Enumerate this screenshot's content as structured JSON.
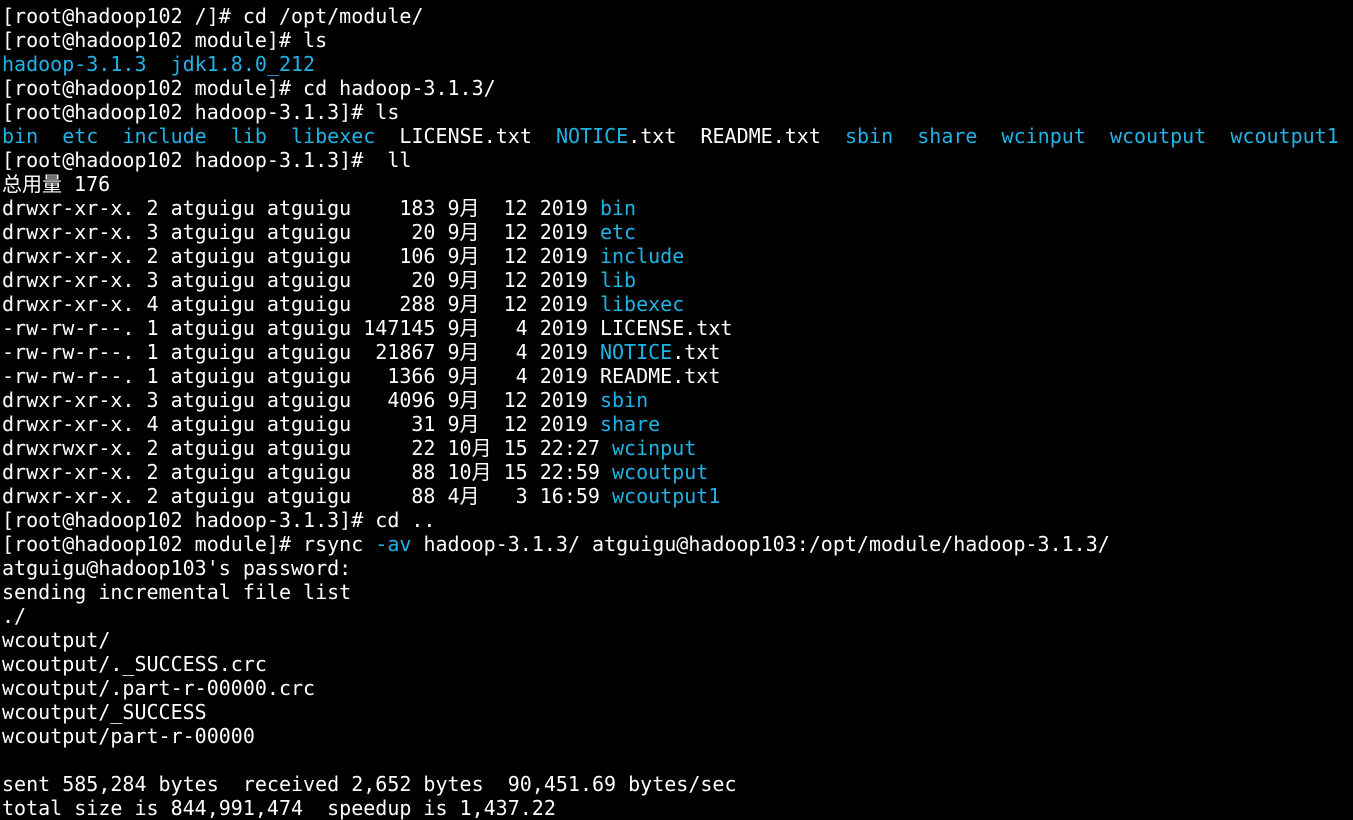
{
  "colors": {
    "background": "#000000",
    "foreground": "#ffffff",
    "directory": "#1fb3e6"
  },
  "lines": [
    [
      {
        "t": "[root@hadoop102 /]# cd /opt/module/",
        "c": "white"
      }
    ],
    [
      {
        "t": "[root@hadoop102 module]# ls",
        "c": "white"
      }
    ],
    [
      {
        "t": "hadoop-3.1.3",
        "c": "blue"
      },
      {
        "t": "  ",
        "c": "white"
      },
      {
        "t": "jdk1.8.0_212",
        "c": "blue"
      }
    ],
    [
      {
        "t": "[root@hadoop102 module]# cd hadoop-3.1.3/",
        "c": "white"
      }
    ],
    [
      {
        "t": "[root@hadoop102 hadoop-3.1.3]# ls",
        "c": "white"
      }
    ],
    [
      {
        "t": "bin",
        "c": "blue"
      },
      {
        "t": "  ",
        "c": "white"
      },
      {
        "t": "etc",
        "c": "blue"
      },
      {
        "t": "  ",
        "c": "white"
      },
      {
        "t": "include",
        "c": "blue"
      },
      {
        "t": "  ",
        "c": "white"
      },
      {
        "t": "lib",
        "c": "blue"
      },
      {
        "t": "  ",
        "c": "white"
      },
      {
        "t": "libexec",
        "c": "blue"
      },
      {
        "t": "  LICENSE.txt  ",
        "c": "white"
      },
      {
        "t": "NOTICE",
        "c": "blue"
      },
      {
        "t": ".txt  README.txt  ",
        "c": "white"
      },
      {
        "t": "sbin",
        "c": "blue"
      },
      {
        "t": "  ",
        "c": "white"
      },
      {
        "t": "share",
        "c": "blue"
      },
      {
        "t": "  ",
        "c": "white"
      },
      {
        "t": "wcinput",
        "c": "blue"
      },
      {
        "t": "  ",
        "c": "white"
      },
      {
        "t": "wcoutput",
        "c": "blue"
      },
      {
        "t": "  ",
        "c": "white"
      },
      {
        "t": "wcoutput1",
        "c": "blue"
      }
    ],
    [
      {
        "t": "[root@hadoop102 hadoop-3.1.3]#  ll",
        "c": "white"
      }
    ],
    [
      {
        "t": "总用量 176",
        "c": "white"
      }
    ],
    [
      {
        "t": "drwxr-xr-x. 2 atguigu atguigu    183 9月  12 2019 ",
        "c": "white"
      },
      {
        "t": "bin",
        "c": "blue"
      }
    ],
    [
      {
        "t": "drwxr-xr-x. 3 atguigu atguigu     20 9月  12 2019 ",
        "c": "white"
      },
      {
        "t": "etc",
        "c": "blue"
      }
    ],
    [
      {
        "t": "drwxr-xr-x. 2 atguigu atguigu    106 9月  12 2019 ",
        "c": "white"
      },
      {
        "t": "include",
        "c": "blue"
      }
    ],
    [
      {
        "t": "drwxr-xr-x. 3 atguigu atguigu     20 9月  12 2019 ",
        "c": "white"
      },
      {
        "t": "lib",
        "c": "blue"
      }
    ],
    [
      {
        "t": "drwxr-xr-x. 4 atguigu atguigu    288 9月  12 2019 ",
        "c": "white"
      },
      {
        "t": "libexec",
        "c": "blue"
      }
    ],
    [
      {
        "t": "-rw-rw-r--. 1 atguigu atguigu 147145 9月   4 2019 LICENSE.txt",
        "c": "white"
      }
    ],
    [
      {
        "t": "-rw-rw-r--. 1 atguigu atguigu  21867 9月   4 2019 ",
        "c": "white"
      },
      {
        "t": "NOTICE",
        "c": "blue"
      },
      {
        "t": ".txt",
        "c": "white"
      }
    ],
    [
      {
        "t": "-rw-rw-r--. 1 atguigu atguigu   1366 9月   4 2019 README.txt",
        "c": "white"
      }
    ],
    [
      {
        "t": "drwxr-xr-x. 3 atguigu atguigu   4096 9月  12 2019 ",
        "c": "white"
      },
      {
        "t": "sbin",
        "c": "blue"
      }
    ],
    [
      {
        "t": "drwxr-xr-x. 4 atguigu atguigu     31 9月  12 2019 ",
        "c": "white"
      },
      {
        "t": "share",
        "c": "blue"
      }
    ],
    [
      {
        "t": "drwxrwxr-x. 2 atguigu atguigu     22 10月 15 22:27 ",
        "c": "white"
      },
      {
        "t": "wcinput",
        "c": "blue"
      }
    ],
    [
      {
        "t": "drwxr-xr-x. 2 atguigu atguigu     88 10月 15 22:59 ",
        "c": "white"
      },
      {
        "t": "wcoutput",
        "c": "blue"
      }
    ],
    [
      {
        "t": "drwxr-xr-x. 2 atguigu atguigu     88 4月   3 16:59 ",
        "c": "white"
      },
      {
        "t": "wcoutput1",
        "c": "blue"
      }
    ],
    [
      {
        "t": "[root@hadoop102 hadoop-3.1.3]# cd ..",
        "c": "white"
      }
    ],
    [
      {
        "t": "[root@hadoop102 module]# rsync ",
        "c": "white"
      },
      {
        "t": "-av",
        "c": "blue"
      },
      {
        "t": " hadoop-3.1.3/ atguigu@hadoop103:/opt/module/hadoop-3.1.3/",
        "c": "white"
      }
    ],
    [
      {
        "t": "atguigu@hadoop103's password:",
        "c": "white"
      }
    ],
    [
      {
        "t": "sending incremental file list",
        "c": "white"
      }
    ],
    [
      {
        "t": "./",
        "c": "white"
      }
    ],
    [
      {
        "t": "wcoutput/",
        "c": "white"
      }
    ],
    [
      {
        "t": "wcoutput/._SUCCESS.crc",
        "c": "white"
      }
    ],
    [
      {
        "t": "wcoutput/.part-r-00000.crc",
        "c": "white"
      }
    ],
    [
      {
        "t": "wcoutput/_SUCCESS",
        "c": "white"
      }
    ],
    [
      {
        "t": "wcoutput/part-r-00000",
        "c": "white"
      }
    ],
    [
      {
        "t": "",
        "c": "white"
      }
    ],
    [
      {
        "t": "sent 585,284 bytes  received 2,652 bytes  90,451.69 bytes/sec",
        "c": "white"
      }
    ],
    [
      {
        "t": "total size is 844,991,474  speedup is 1,437.22",
        "c": "white"
      }
    ]
  ]
}
